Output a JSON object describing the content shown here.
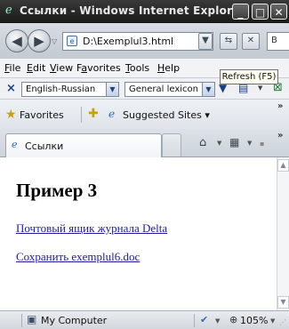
{
  "window": {
    "title": "Ссылки - Windows Internet Explorer"
  },
  "caption_buttons": {
    "minimize": "_",
    "maximize": "□",
    "close": "✕"
  },
  "address": {
    "url": "D:\\Exemplul3.html",
    "search_partial": "B"
  },
  "tooltip": {
    "text": "Refresh (F5)"
  },
  "menu": {
    "items": [
      {
        "key": "F",
        "rest": "ile"
      },
      {
        "key": "E",
        "rest": "dit"
      },
      {
        "key": "V",
        "rest": "iew"
      },
      {
        "pre": "F",
        "key": "a",
        "rest": "vorites"
      },
      {
        "key": "T",
        "rest": "ools"
      },
      {
        "key": "H",
        "rest": "elp"
      }
    ]
  },
  "translation_toolbar": {
    "close": "×",
    "language_pair": "English-Russian",
    "dictionary": "General lexicon"
  },
  "favorites_bar": {
    "favorites_label": "Favorites",
    "suggested_label": "Suggested Sites",
    "chevron": "»"
  },
  "tabs": [
    {
      "label": "Ссылки"
    }
  ],
  "page": {
    "heading": "Пример 3",
    "links": [
      {
        "text": "Почтовый ящик журнала Delta"
      },
      {
        "text": "Сохранить exemplul6.doc"
      }
    ]
  },
  "status": {
    "zone": "My Computer",
    "zoom": "105%"
  },
  "icons": {
    "back": "back-arrow-icon",
    "forward": "forward-arrow-icon",
    "refresh": "refresh-icon",
    "stop": "stop-icon",
    "home": "home-icon",
    "feeds": "rss-feed-icon",
    "favorites": "star-icon",
    "computer": "computer-icon"
  },
  "colors": {
    "titlebar": "#2a2a2a",
    "link": "#1c1ca8",
    "chrome": "#d3d8de"
  }
}
